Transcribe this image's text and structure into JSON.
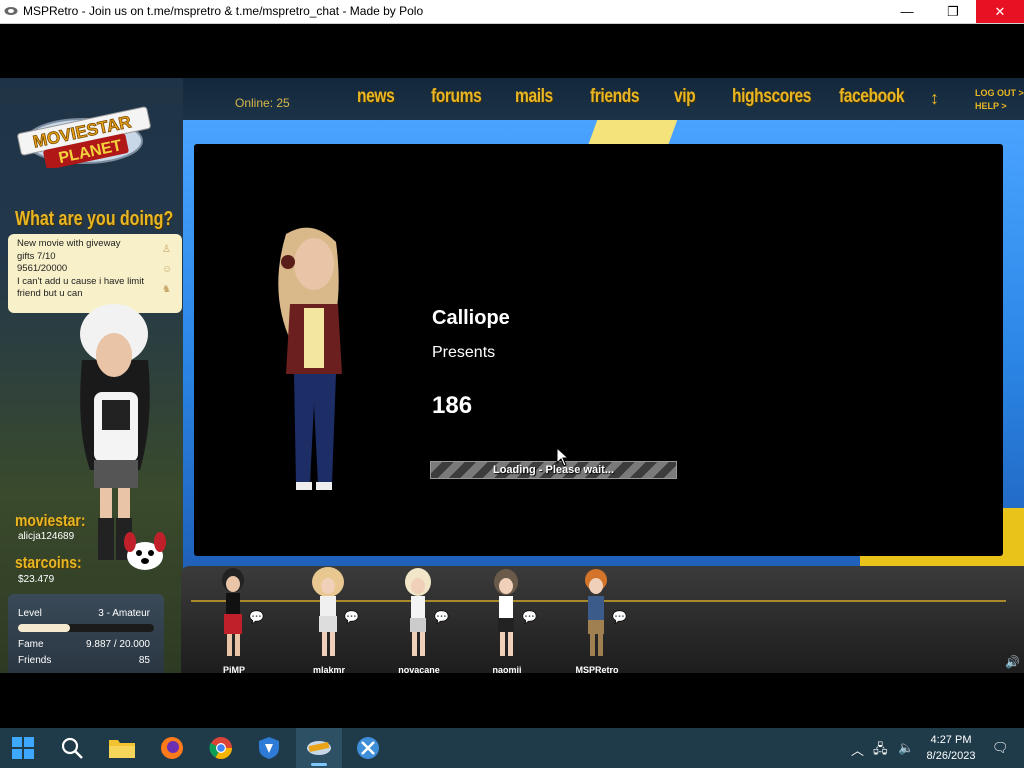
{
  "window": {
    "title": "MSPRetro - Join us on t.me/mspretro & t.me/mspretro_chat - Made by Polo",
    "minimize_glyph": "—",
    "maximize_glyph": "❐",
    "close_glyph": "✕"
  },
  "nav": {
    "online": "Online: 25",
    "items": [
      "news",
      "forums",
      "mails",
      "friends",
      "vip",
      "highscores",
      "facebook"
    ],
    "logout": "LOG OUT >",
    "help": "HELP >"
  },
  "logo": {
    "line1": "MOVIESTAR",
    "line2": "PLANET"
  },
  "status": {
    "heading": "What are you doing?",
    "text_lines": [
      "New movie with  giveway",
      "gifts 7/10",
      "9561/20000",
      "I can't add u cause i have limit",
      "friend but u can"
    ]
  },
  "profile": {
    "moviestar_label": "moviestar:",
    "moviestar_name": "alicja124689",
    "starcoins_label": "starcoins:",
    "starcoins_value": "$23.479",
    "level_label": "Level",
    "level_value": "3 - Amateur",
    "level_progress": 0.38,
    "fame_label": "Fame",
    "fame_value": "9.887 / 20.000",
    "friends_label": "Friends",
    "friends_value": "85"
  },
  "loading": {
    "name": "Calliope",
    "presents": "Presents",
    "number": "186",
    "bar_text": "Loading - Please wait..."
  },
  "friends": [
    "PiMP",
    "mlakmr",
    "novacane",
    "naomii",
    "MSPRetro"
  ],
  "taskbar": {
    "time": "4:27 PM",
    "date": "8/26/2023"
  },
  "colors": {
    "gold": "#e8b623",
    "taskbar": "#1f3a48",
    "close_red": "#e81123"
  }
}
